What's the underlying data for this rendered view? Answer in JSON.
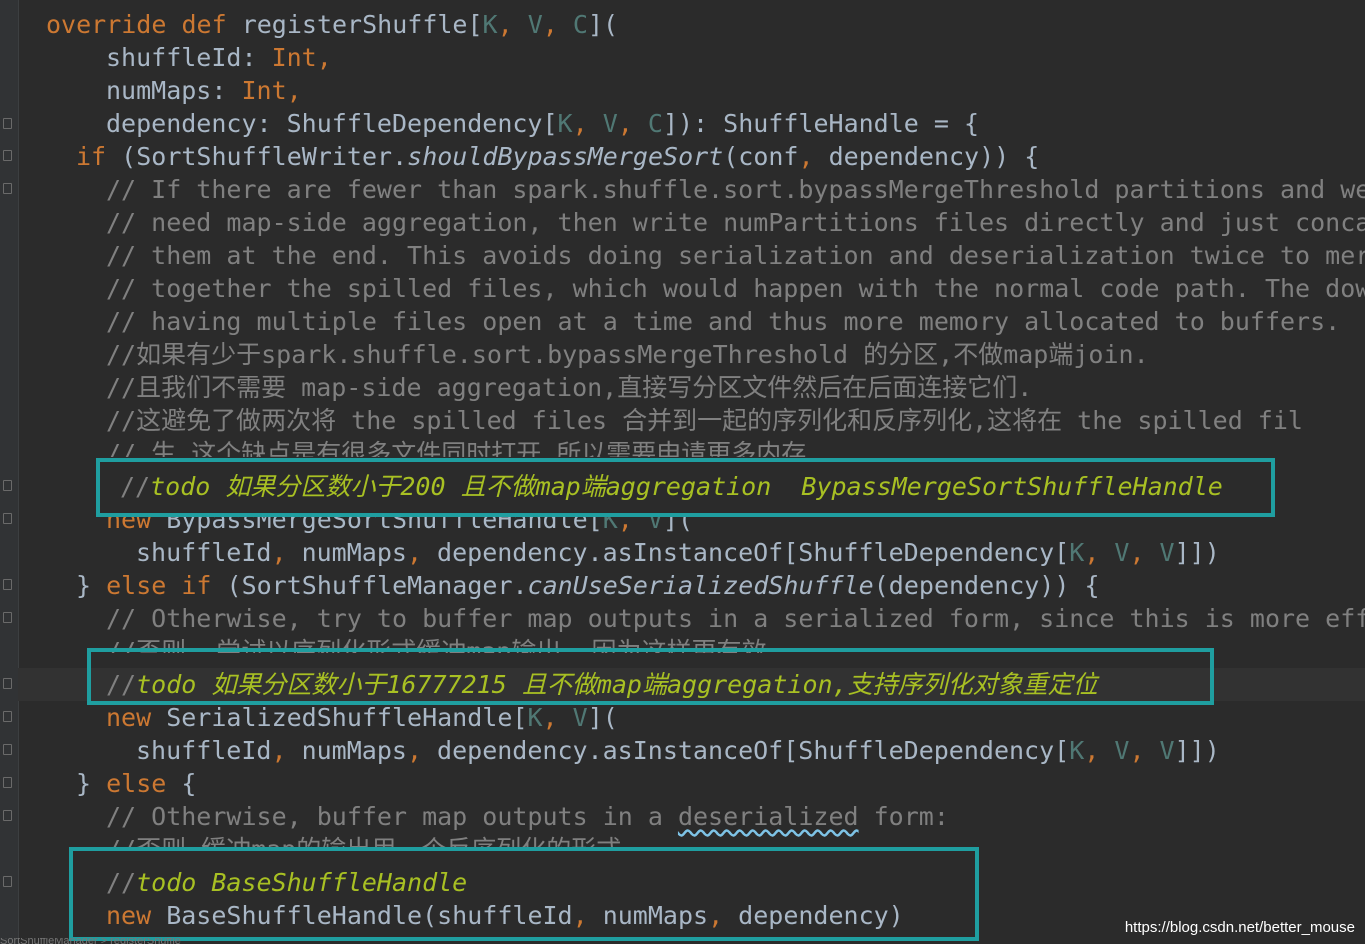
{
  "code": {
    "l01": {
      "a": "override",
      "b": "def",
      "c": "registerShuffle[",
      "d": "K",
      "e": ", ",
      "f": "V",
      "g": ", ",
      "h": "C",
      "i": "]("
    },
    "l02": {
      "a": "shuffleId: ",
      "b": "Int",
      "c": ","
    },
    "l03": {
      "a": "numMaps: ",
      "b": "Int",
      "c": ","
    },
    "l04": {
      "a": "dependency: ShuffleDependency[",
      "b": "K",
      "c": ", ",
      "d": "V",
      "e": ", ",
      "f": "C",
      "g": "]): ShuffleHandle = {"
    },
    "l05": {
      "a": "if",
      "b": " (SortShuffleWriter.",
      "c": "shouldBypassMergeSort",
      "d": "(conf",
      "e": ", ",
      "f": "dependency)) {"
    },
    "l06": "// If there are fewer than spark.shuffle.sort.bypassMergeThreshold partitions and we",
    "l07": "// need map-side aggregation, then write numPartitions files directly and just conca",
    "l08": "// them at the end. This avoids doing serialization and deserialization twice to mer",
    "l09": "// together the spilled files, which would happen with the normal code path. The dow",
    "l10": "// having multiple files open at a time and thus more memory allocated to buffers.",
    "l11": "//如果有少于spark.shuffle.sort.bypassMergeThreshold 的分区,不做map端join.",
    "l12": "//且我们不需要 map-side aggregation,直接写分区文件然后在后面连接它们.",
    "l13": "//这避免了做两次将 the spilled files 合并到一起的序列化和反序列化,这将在 the spilled fil",
    "l14": "// 生.这个缺点是有很多文件同时打开,所以需要申请更多内存.",
    "l15": {
      "a": "//",
      "b": "todo 如果分区数小于200 且不做map端aggregation  BypassMergeSortShuffleHandle"
    },
    "l16": {
      "a": "new",
      "b": " BypassMergeSortShuffleHandle[",
      "c": "K",
      "d": ", ",
      "e": "V",
      "f": "]("
    },
    "l17": {
      "a": "shuffleId",
      "b": ", ",
      "c": "numMaps",
      "d": ", ",
      "e": "dependency.asInstanceOf[ShuffleDependency[",
      "f": "K",
      "g": ", ",
      "h": "V",
      "i": ", ",
      "j": "V",
      "k": "]])"
    },
    "l18": {
      "a": "} ",
      "b": "else if",
      "c": " (SortShuffleManager.",
      "d": "canUseSerializedShuffle",
      "e": "(dependency)) {"
    },
    "l19": "// Otherwise, try to buffer map outputs in a serialized form, since this is more eff",
    "l20": "//否则, 尝试以序列化形式缓冲map输出, 因为这样更有效.",
    "l21": {
      "a": "//",
      "b": "todo 如果分区数小于16777215 且不做map端aggregation,支持序列化对象重定位"
    },
    "l22": {
      "a": "new",
      "b": " SerializedShuffleHandle[",
      "c": "K",
      "d": ", ",
      "e": "V",
      "f": "]("
    },
    "l23": {
      "a": "shuffleId",
      "b": ", ",
      "c": "numMaps",
      "d": ", ",
      "e": "dependency.asInstanceOf[ShuffleDependency[",
      "f": "K",
      "g": ", ",
      "h": "V",
      "i": ", ",
      "j": "V",
      "k": "]])"
    },
    "l24": {
      "a": "} ",
      "b": "else",
      "c": " {"
    },
    "l25": {
      "a": "// Otherwise, buffer map outputs in a ",
      "b": "deserialized",
      "c": " form:"
    },
    "l26": "//否则,缓冲map的输出用一个反序列化的形式.",
    "l27": {
      "a": "//",
      "b": "todo BaseShuffleHandle"
    },
    "l28": {
      "a": "new",
      "b": " BaseShuffleHandle(shuffleId",
      "c": ", ",
      "d": "numMaps",
      "e": ", ",
      "f": "dependency)"
    }
  },
  "statusbar": {
    "text": "SortShuffleManager  >  registerShuffle"
  },
  "watermark": "https://blog.csdn.net/better_mouse",
  "colors": {
    "background": "#2b2b2b",
    "keyword": "#cc7832",
    "type_param": "#507874",
    "comment": "#808080",
    "todo": "#a8c023",
    "highlight_box": "#1f9ea0"
  }
}
